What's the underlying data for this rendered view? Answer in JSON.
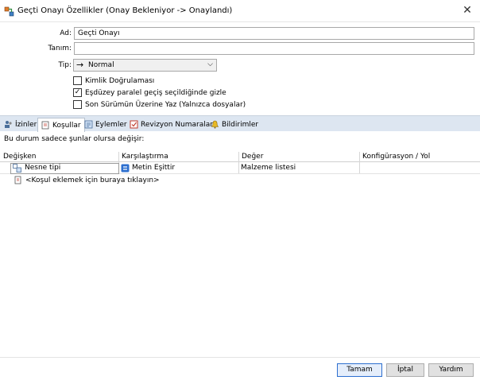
{
  "window": {
    "title": "Geçti Onayı Özellikler (Onay Bekleniyor -> Onaylandı)"
  },
  "form": {
    "name_label": "Ad:",
    "name_value": "Geçti Onayı",
    "desc_label": "Tanım:",
    "desc_value": "",
    "type_label": "Tip:",
    "type_value": "Normal",
    "checkboxes": [
      {
        "label": "Kimlik Doğrulaması",
        "checked": false
      },
      {
        "label": "Eşdüzey paralel geçiş seçildiğinde gizle",
        "checked": true
      },
      {
        "label": "Son Sürümün Üzerine Yaz (Yalnızca dosyalar)",
        "checked": false
      }
    ]
  },
  "tabs": [
    {
      "label": "İzinler",
      "active": false
    },
    {
      "label": "Koşullar",
      "active": true
    },
    {
      "label": "Eylemler",
      "active": false
    },
    {
      "label": "Revizyon Numaraları",
      "active": false
    },
    {
      "label": "Bildirimler",
      "active": false
    }
  ],
  "conditions": {
    "subtitle": "Bu durum sadece şunlar olursa değişir:",
    "columns": [
      "Değişken",
      "Karşılaştırma",
      "Değer",
      "Konfigürasyon / Yol"
    ],
    "rows": [
      {
        "variable": "Nesne tipi",
        "comparison": "Metin Eşittir",
        "value": "Malzeme listesi",
        "config": ""
      }
    ],
    "add_prompt": "<Koşul eklemek için buraya tıklayın>"
  },
  "buttons": {
    "ok": "Tamam",
    "cancel": "İptal",
    "help": "Yardım"
  },
  "colors": {
    "tabbar_bg": "#dde6f1",
    "accent": "#2d6fcf"
  }
}
